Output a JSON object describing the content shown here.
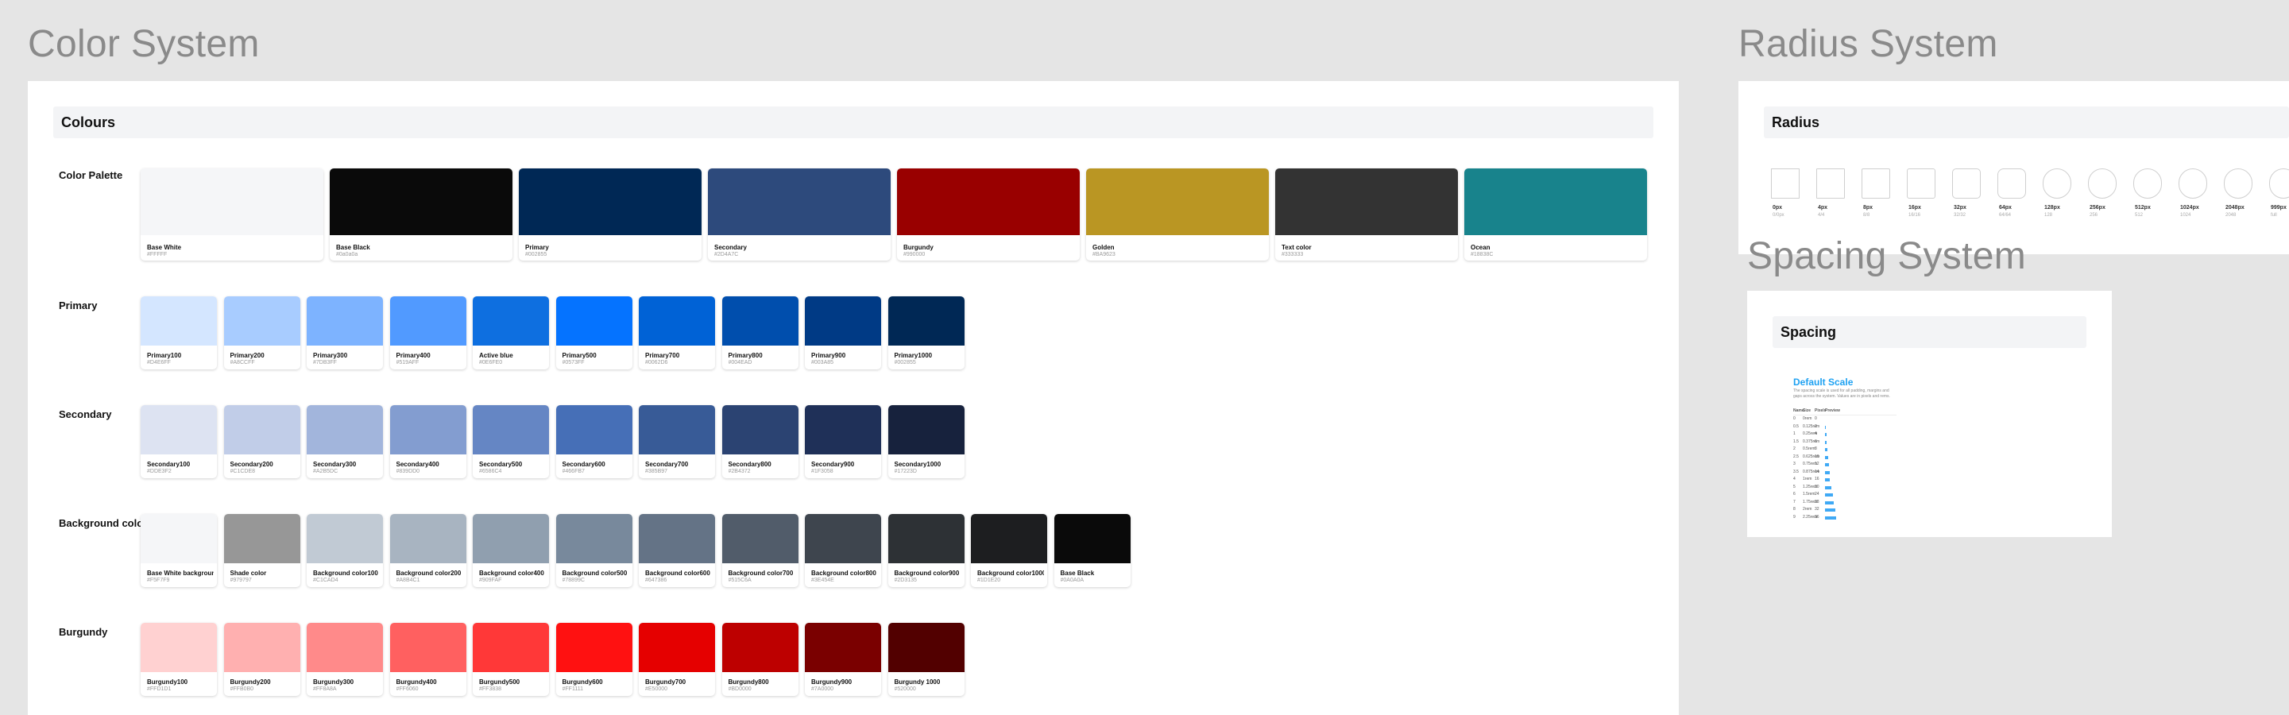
{
  "color_section": {
    "title": "Color System",
    "header": "Colours",
    "palette": {
      "label": "Color Palette",
      "items": [
        {
          "name": "Base White",
          "hex": "#FFFFF",
          "color": "#f5f6f8"
        },
        {
          "name": "Base Black",
          "hex": "#0a0a0a",
          "color": "#0a0a0a"
        },
        {
          "name": "Primary",
          "hex": "#002855",
          "color": "#002855"
        },
        {
          "name": "Secondary",
          "hex": "#2D4A7C",
          "color": "#2d4a7c"
        },
        {
          "name": "Burgundy",
          "hex": "#990000",
          "color": "#990000"
        },
        {
          "name": "Golden",
          "hex": "#BA9623",
          "color": "#ba9623"
        },
        {
          "name": "Text color",
          "hex": "#333333",
          "color": "#333333"
        },
        {
          "name": "Ocean",
          "hex": "#18838C",
          "color": "#18838c"
        }
      ]
    },
    "rows": [
      {
        "label": "Primary",
        "items": [
          {
            "name": "Primary100",
            "hex": "#D4E6FF",
            "color": "#d4e6ff"
          },
          {
            "name": "Primary200",
            "hex": "#A8CCFF",
            "color": "#a8ccff"
          },
          {
            "name": "Primary300",
            "hex": "#7DB3FF",
            "color": "#7db3ff"
          },
          {
            "name": "Primary400",
            "hex": "#519AFF",
            "color": "#519aff"
          },
          {
            "name": "Active blue",
            "hex": "#0E6FE0",
            "color": "#0e6fe0"
          },
          {
            "name": "Primary500",
            "hex": "#0573FF",
            "color": "#0573ff"
          },
          {
            "name": "Primary700",
            "hex": "#0062D6",
            "color": "#0062d6"
          },
          {
            "name": "Primary800",
            "hex": "#004EAD",
            "color": "#004ead"
          },
          {
            "name": "Primary900",
            "hex": "#003A85",
            "color": "#003a85"
          },
          {
            "name": "Primary1000",
            "hex": "#002855",
            "color": "#002855"
          }
        ]
      },
      {
        "label": "Secondary",
        "items": [
          {
            "name": "Secondary100",
            "hex": "#DDE3F2",
            "color": "#dde3f2"
          },
          {
            "name": "Secondary200",
            "hex": "#C1CDE8",
            "color": "#c1cde8"
          },
          {
            "name": "Secondary300",
            "hex": "#A2B5DC",
            "color": "#a2b5dc"
          },
          {
            "name": "Secondary400",
            "hex": "#839DD0",
            "color": "#839dd0"
          },
          {
            "name": "Secondary500",
            "hex": "#6586C4",
            "color": "#6586c4"
          },
          {
            "name": "Secondary600",
            "hex": "#466FB7",
            "color": "#466fb7"
          },
          {
            "name": "Secondary700",
            "hex": "#385B97",
            "color": "#385b97"
          },
          {
            "name": "Secondary800",
            "hex": "#2B4372",
            "color": "#2b4372"
          },
          {
            "name": "Secondary900",
            "hex": "#1F3058",
            "color": "#1f3058"
          },
          {
            "name": "Secondary1000",
            "hex": "#17223D",
            "color": "#17223d"
          }
        ]
      },
      {
        "label": "Background color",
        "items": [
          {
            "name": "Base White background",
            "hex": "#F5F7F9",
            "color": "#f5f6f8"
          },
          {
            "name": "Shade color",
            "hex": "#979797",
            "color": "#979797"
          },
          {
            "name": "Background color100",
            "hex": "#C1CAD4",
            "color": "#c1cad4"
          },
          {
            "name": "Background color200",
            "hex": "#A8B4C1",
            "color": "#a8b4c1"
          },
          {
            "name": "Background color400",
            "hex": "#909FAF",
            "color": "#909faf"
          },
          {
            "name": "Background color500",
            "hex": "#78899C",
            "color": "#78899c"
          },
          {
            "name": "Background color600",
            "hex": "#647386",
            "color": "#647386"
          },
          {
            "name": "Background color700",
            "hex": "#515C6A",
            "color": "#515c6a"
          },
          {
            "name": "Background color800",
            "hex": "#3E454E",
            "color": "#3e454e"
          },
          {
            "name": "Background color900",
            "hex": "#2D3135",
            "color": "#2d3135"
          },
          {
            "name": "Background color1000",
            "hex": "#1D1E20",
            "color": "#1d1e20"
          },
          {
            "name": "Base Black",
            "hex": "#0A0A0A",
            "color": "#0a0a0a"
          }
        ]
      },
      {
        "label": "Burgundy",
        "items": [
          {
            "name": "Burgundy100",
            "hex": "#FFD1D1",
            "color": "#ffd1d1"
          },
          {
            "name": "Burgundy200",
            "hex": "#FFB0B0",
            "color": "#ffb0b0"
          },
          {
            "name": "Burgundy300",
            "hex": "#FF8A8A",
            "color": "#ff8a8a"
          },
          {
            "name": "Burgundy400",
            "hex": "#FF6060",
            "color": "#ff6060"
          },
          {
            "name": "Burgundy500",
            "hex": "#FF3838",
            "color": "#ff3838"
          },
          {
            "name": "Burgundy600",
            "hex": "#FF1111",
            "color": "#ff1111"
          },
          {
            "name": "Burgundy700",
            "hex": "#E50000",
            "color": "#e50000"
          },
          {
            "name": "Burgundy800",
            "hex": "#BD0000",
            "color": "#bd0000"
          },
          {
            "name": "Burgundy900",
            "hex": "#7A0000",
            "color": "#7a0000"
          },
          {
            "name": "Burgundy 1000",
            "hex": "#520000",
            "color": "#520000"
          }
        ]
      }
    ]
  },
  "radius_section": {
    "title": "Radius System",
    "header": "Radius",
    "items": [
      {
        "label": "0px",
        "sub": "0/0px",
        "r": 0
      },
      {
        "label": "4px",
        "sub": "4/4",
        "r": 1
      },
      {
        "label": "8px",
        "sub": "8/8",
        "r": 2
      },
      {
        "label": "16px",
        "sub": "16/16",
        "r": 3
      },
      {
        "label": "32px",
        "sub": "32/32",
        "r": 5
      },
      {
        "label": "64px",
        "sub": "64/64",
        "r": 8
      },
      {
        "label": "128px",
        "sub": "128",
        "r": 18
      },
      {
        "label": "256px",
        "sub": "256",
        "r": 18
      },
      {
        "label": "512px",
        "sub": "512",
        "r": 18
      },
      {
        "label": "1024px",
        "sub": "1024",
        "r": 18
      },
      {
        "label": "2048px",
        "sub": "2048",
        "r": 18
      },
      {
        "label": "999px",
        "sub": "full",
        "r": 18
      }
    ]
  },
  "spacing_section": {
    "title": "Spacing System",
    "header": "Spacing",
    "doc_title": "Default Scale",
    "doc_desc": "The spacing scale is used for all padding, margins and gaps across the system. Values are in pixels and rems.",
    "columns": [
      "Name",
      "Size",
      "Pixels",
      "Preview"
    ],
    "rows": [
      {
        "name": "0",
        "size": "0rem",
        "px": "0",
        "bar": 0
      },
      {
        "name": "0.5",
        "size": "0.125rem",
        "px": "2",
        "bar": 1
      },
      {
        "name": "1",
        "size": "0.25rem",
        "px": "4",
        "bar": 2
      },
      {
        "name": "1.5",
        "size": "0.375rem",
        "px": "6",
        "bar": 3
      },
      {
        "name": "2",
        "size": "0.5rem",
        "px": "8",
        "bar": 4
      },
      {
        "name": "2.5",
        "size": "0.625rem",
        "px": "10",
        "bar": 5
      },
      {
        "name": "3",
        "size": "0.75rem",
        "px": "12",
        "bar": 6
      },
      {
        "name": "3.5",
        "size": "0.875rem",
        "px": "14",
        "bar": 7
      },
      {
        "name": "4",
        "size": "1rem",
        "px": "16",
        "bar": 8
      },
      {
        "name": "5",
        "size": "1.25rem",
        "px": "20",
        "bar": 10
      },
      {
        "name": "6",
        "size": "1.5rem",
        "px": "24",
        "bar": 12
      },
      {
        "name": "7",
        "size": "1.75rem",
        "px": "28",
        "bar": 14
      },
      {
        "name": "8",
        "size": "2rem",
        "px": "32",
        "bar": 16
      },
      {
        "name": "9",
        "size": "2.25rem",
        "px": "36",
        "bar": 18
      }
    ]
  }
}
